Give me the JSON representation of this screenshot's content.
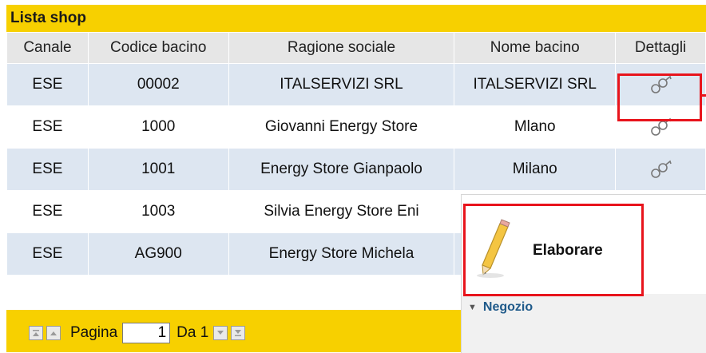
{
  "list": {
    "title": "Lista shop",
    "columns": [
      "Canale",
      "Codice bacino",
      "Ragione sociale",
      "Nome bacino",
      "Dettagli"
    ],
    "rows": [
      {
        "canale": "ESE",
        "codice": "00002",
        "ragione": "ITALSERVIZI SRL",
        "nome": "ITALSERVIZI SRL",
        "dettagli_icon": "details-glasses-icon"
      },
      {
        "canale": "ESE",
        "codice": "1000",
        "ragione": "Giovanni Energy Store",
        "nome": "Mlano",
        "dettagli_icon": "details-glasses-icon"
      },
      {
        "canale": "ESE",
        "codice": "1001",
        "ragione": "Energy Store Gianpaolo",
        "nome": "Milano",
        "dettagli_icon": "details-glasses-icon"
      },
      {
        "canale": "ESE",
        "codice": "1003",
        "ragione": "Silvia Energy Store Eni",
        "nome": "",
        "dettagli_icon": ""
      },
      {
        "canale": "ESE",
        "codice": "AG900",
        "ragione": "Energy Store Michela",
        "nome": "",
        "dettagli_icon": ""
      }
    ]
  },
  "pager": {
    "page_label": "Pagina",
    "page_value": "1",
    "of_label": "Da 1",
    "first_icon": "first-page-icon",
    "prev_icon": "prev-page-icon",
    "next_icon": "next-page-icon",
    "last_icon": "last-page-icon"
  },
  "popup": {
    "action_label": "Elaborare",
    "action_icon": "pencil-icon",
    "section_label": "Negozio",
    "section_icon": "collapse-triangle-icon"
  },
  "colors": {
    "header_yellow": "#f7d000",
    "row_blue": "#dde6f1",
    "highlight_red": "#e8141c",
    "section_blue": "#1f5a8a"
  }
}
